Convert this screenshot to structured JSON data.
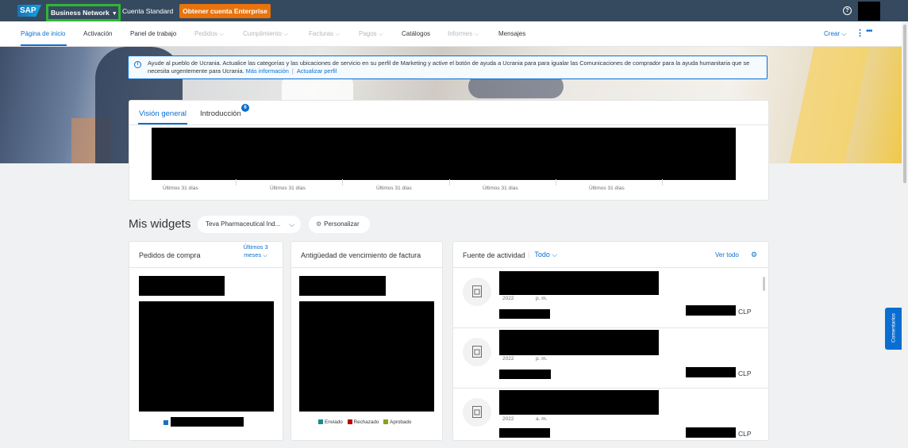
{
  "shell": {
    "logo": "SAP",
    "network_label": "Business Network",
    "account_type": "Cuenta Standard",
    "upgrade_button": "Obtener cuenta Enterprise",
    "help_icon": "question-icon"
  },
  "nav": {
    "items": [
      {
        "label": "Página de inicio"
      },
      {
        "label": "Activación"
      },
      {
        "label": "Panel de trabajo"
      },
      {
        "label": "Pedidos ⌵"
      },
      {
        "label": "Cumplimiento ⌵"
      },
      {
        "label": "Facturas ⌵"
      },
      {
        "label": "Pagos ⌵"
      },
      {
        "label": "Catálogos"
      },
      {
        "label": "Informes ⌵"
      },
      {
        "label": "Mensajes"
      }
    ],
    "create": "Crear"
  },
  "banner": {
    "text": "Ayude al pueblo de Ucrania. Actualice las categorías y las ubicaciones de servicio en su perfil de Marketing y active el botón de ayuda a Ucrania para para igualar las Comunicaciones de comprador para la ayuda humanitaria que se necesita urgentemente para Ucrania.",
    "link1": "Más información",
    "link2": "Actualizar perfil"
  },
  "overview": {
    "tab1": "Visión general",
    "tab2": "Introducción",
    "tab2_badge": "6",
    "periods": [
      "Últimos 31 días",
      "Últimos 31 días",
      "Últimos 31 días",
      "Últimos 31 días",
      "Últimos 31 días"
    ]
  },
  "widgets": {
    "title": "Mis widgets",
    "selector": "Teva Pharmaceutical Ind...",
    "customize": "Personalizar",
    "purchase_orders": {
      "title": "Pedidos de compra",
      "filter": "Últimos 3 meses"
    },
    "invoice_aging": {
      "title": "Antigüedad de vencimiento de factura",
      "legend": [
        {
          "label": "Enviado",
          "color": "#1d8a8a"
        },
        {
          "label": "Rechazado",
          "color": "#bb0000"
        },
        {
          "label": "Aprobado",
          "color": "#8aa21a"
        }
      ]
    },
    "activity": {
      "title": "Fuente de actividad",
      "filter": "Todo",
      "view_all": "Ver todo",
      "items": [
        {
          "year": "2022",
          "ampm": "p. m.",
          "currency": "CLP"
        },
        {
          "year": "2022",
          "ampm": "p. m.",
          "currency": "CLP"
        },
        {
          "year": "2022",
          "ampm": "a. m.",
          "currency": "CLP"
        }
      ]
    }
  },
  "feedback": "Comentarios"
}
